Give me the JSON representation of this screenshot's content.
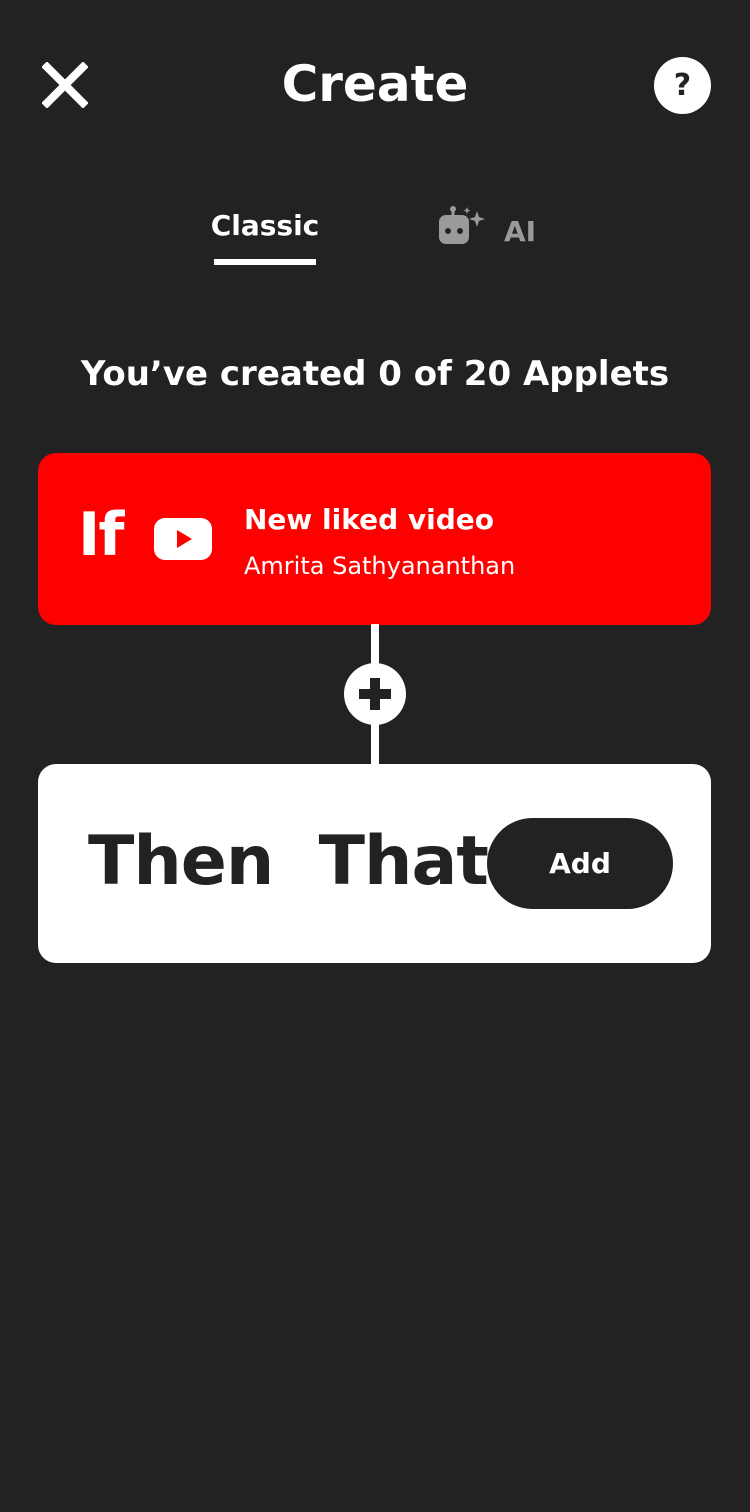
{
  "header": {
    "title": "Create",
    "close_icon": "close-icon",
    "help_label": "?",
    "help_icon": "help-icon"
  },
  "tabs": [
    {
      "label": "Classic",
      "selected": true
    },
    {
      "label": "AI",
      "selected": false,
      "icon": "robot-sparkle-icon"
    }
  ],
  "applet_count_text": "You’ve created 0 of 20 Applets",
  "if_card": {
    "prefix": "If",
    "service_icon": "youtube-icon",
    "trigger_title": "New liked video",
    "account_name": "Amrita Sathyananthan",
    "color": "#ff0000"
  },
  "connector": {
    "icon": "plus-icon"
  },
  "then_card": {
    "label": "Then  That",
    "add_label": "Add"
  },
  "colors": {
    "background": "#222222",
    "accent": "#ff0000",
    "inactive_tab": "#9a9a9a"
  }
}
